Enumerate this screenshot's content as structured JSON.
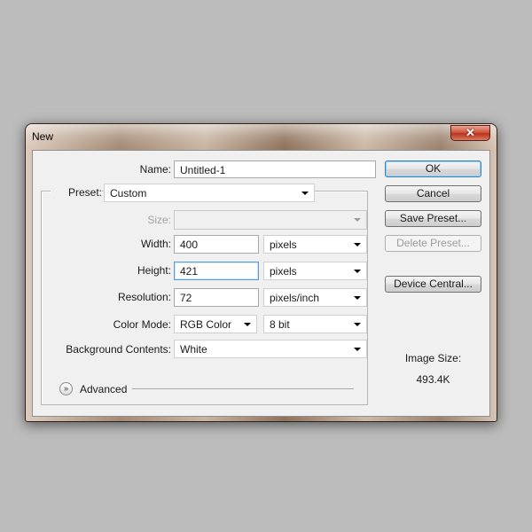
{
  "window": {
    "title": "New",
    "close_glyph": "✕"
  },
  "form": {
    "name_label": "Name:",
    "name_value": "Untitled-1",
    "preset_label": "Preset:",
    "preset_value": "Custom",
    "size_label": "Size:",
    "size_value": "",
    "width_label": "Width:",
    "width_value": "400",
    "width_unit": "pixels",
    "height_label": "Height:",
    "height_value": "421",
    "height_unit": "pixels",
    "resolution_label": "Resolution:",
    "resolution_value": "72",
    "resolution_unit": "pixels/inch",
    "color_mode_label": "Color Mode:",
    "color_mode_value": "RGB Color",
    "bit_depth_value": "8 bit",
    "background_label": "Background Contents:",
    "background_value": "White",
    "advanced_label": "Advanced"
  },
  "buttons": {
    "ok": "OK",
    "cancel": "Cancel",
    "save_preset": "Save Preset...",
    "delete_preset": "Delete Preset...",
    "device_central": "Device Central..."
  },
  "image_size": {
    "label": "Image Size:",
    "value": "493.4K"
  },
  "icons": {
    "advanced_toggle": "double-chevron-down-icon",
    "dropdown": "chevron-down-icon",
    "close": "close-icon"
  }
}
